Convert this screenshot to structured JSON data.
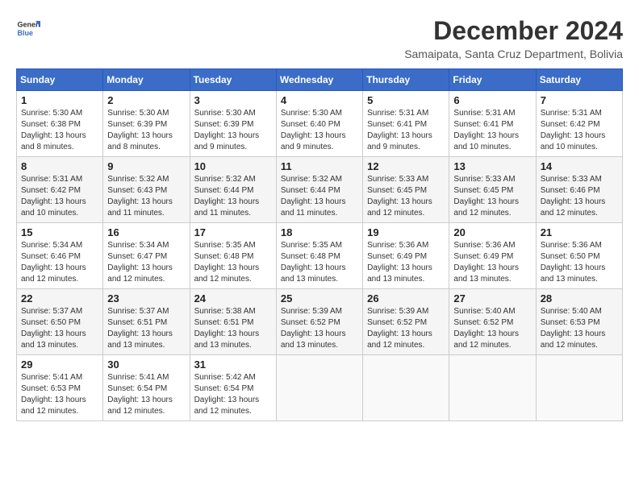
{
  "logo": {
    "line1": "General",
    "line2": "Blue"
  },
  "title": "December 2024",
  "subtitle": "Samaipata, Santa Cruz Department, Bolivia",
  "days_of_week": [
    "Sunday",
    "Monday",
    "Tuesday",
    "Wednesday",
    "Thursday",
    "Friday",
    "Saturday"
  ],
  "weeks": [
    [
      {
        "day": "1",
        "sunrise": "5:30 AM",
        "sunset": "6:38 PM",
        "daylight": "13 hours and 8 minutes."
      },
      {
        "day": "2",
        "sunrise": "5:30 AM",
        "sunset": "6:39 PM",
        "daylight": "13 hours and 8 minutes."
      },
      {
        "day": "3",
        "sunrise": "5:30 AM",
        "sunset": "6:39 PM",
        "daylight": "13 hours and 9 minutes."
      },
      {
        "day": "4",
        "sunrise": "5:30 AM",
        "sunset": "6:40 PM",
        "daylight": "13 hours and 9 minutes."
      },
      {
        "day": "5",
        "sunrise": "5:31 AM",
        "sunset": "6:41 PM",
        "daylight": "13 hours and 9 minutes."
      },
      {
        "day": "6",
        "sunrise": "5:31 AM",
        "sunset": "6:41 PM",
        "daylight": "13 hours and 10 minutes."
      },
      {
        "day": "7",
        "sunrise": "5:31 AM",
        "sunset": "6:42 PM",
        "daylight": "13 hours and 10 minutes."
      }
    ],
    [
      {
        "day": "8",
        "sunrise": "5:31 AM",
        "sunset": "6:42 PM",
        "daylight": "13 hours and 10 minutes."
      },
      {
        "day": "9",
        "sunrise": "5:32 AM",
        "sunset": "6:43 PM",
        "daylight": "13 hours and 11 minutes."
      },
      {
        "day": "10",
        "sunrise": "5:32 AM",
        "sunset": "6:44 PM",
        "daylight": "13 hours and 11 minutes."
      },
      {
        "day": "11",
        "sunrise": "5:32 AM",
        "sunset": "6:44 PM",
        "daylight": "13 hours and 11 minutes."
      },
      {
        "day": "12",
        "sunrise": "5:33 AM",
        "sunset": "6:45 PM",
        "daylight": "13 hours and 12 minutes."
      },
      {
        "day": "13",
        "sunrise": "5:33 AM",
        "sunset": "6:45 PM",
        "daylight": "13 hours and 12 minutes."
      },
      {
        "day": "14",
        "sunrise": "5:33 AM",
        "sunset": "6:46 PM",
        "daylight": "13 hours and 12 minutes."
      }
    ],
    [
      {
        "day": "15",
        "sunrise": "5:34 AM",
        "sunset": "6:46 PM",
        "daylight": "13 hours and 12 minutes."
      },
      {
        "day": "16",
        "sunrise": "5:34 AM",
        "sunset": "6:47 PM",
        "daylight": "13 hours and 12 minutes."
      },
      {
        "day": "17",
        "sunrise": "5:35 AM",
        "sunset": "6:48 PM",
        "daylight": "13 hours and 12 minutes."
      },
      {
        "day": "18",
        "sunrise": "5:35 AM",
        "sunset": "6:48 PM",
        "daylight": "13 hours and 13 minutes."
      },
      {
        "day": "19",
        "sunrise": "5:36 AM",
        "sunset": "6:49 PM",
        "daylight": "13 hours and 13 minutes."
      },
      {
        "day": "20",
        "sunrise": "5:36 AM",
        "sunset": "6:49 PM",
        "daylight": "13 hours and 13 minutes."
      },
      {
        "day": "21",
        "sunrise": "5:36 AM",
        "sunset": "6:50 PM",
        "daylight": "13 hours and 13 minutes."
      }
    ],
    [
      {
        "day": "22",
        "sunrise": "5:37 AM",
        "sunset": "6:50 PM",
        "daylight": "13 hours and 13 minutes."
      },
      {
        "day": "23",
        "sunrise": "5:37 AM",
        "sunset": "6:51 PM",
        "daylight": "13 hours and 13 minutes."
      },
      {
        "day": "24",
        "sunrise": "5:38 AM",
        "sunset": "6:51 PM",
        "daylight": "13 hours and 13 minutes."
      },
      {
        "day": "25",
        "sunrise": "5:39 AM",
        "sunset": "6:52 PM",
        "daylight": "13 hours and 13 minutes."
      },
      {
        "day": "26",
        "sunrise": "5:39 AM",
        "sunset": "6:52 PM",
        "daylight": "13 hours and 12 minutes."
      },
      {
        "day": "27",
        "sunrise": "5:40 AM",
        "sunset": "6:52 PM",
        "daylight": "13 hours and 12 minutes."
      },
      {
        "day": "28",
        "sunrise": "5:40 AM",
        "sunset": "6:53 PM",
        "daylight": "13 hours and 12 minutes."
      }
    ],
    [
      {
        "day": "29",
        "sunrise": "5:41 AM",
        "sunset": "6:53 PM",
        "daylight": "13 hours and 12 minutes."
      },
      {
        "day": "30",
        "sunrise": "5:41 AM",
        "sunset": "6:54 PM",
        "daylight": "13 hours and 12 minutes."
      },
      {
        "day": "31",
        "sunrise": "5:42 AM",
        "sunset": "6:54 PM",
        "daylight": "13 hours and 12 minutes."
      },
      null,
      null,
      null,
      null
    ]
  ]
}
